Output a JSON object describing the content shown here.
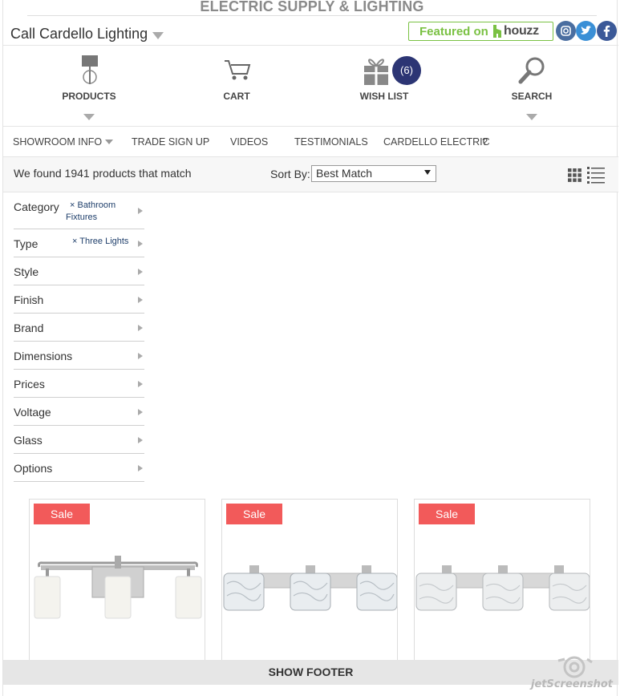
{
  "banner": {
    "text": "ELECTRIC SUPPLY & LIGHTING"
  },
  "header": {
    "call_label": "Call Cardello Lighting",
    "houzz_featured": "Featured on",
    "houzz_brand": "houzz"
  },
  "social": {
    "instagram": "instagram-icon",
    "twitter": "twitter-icon",
    "facebook": "facebook-icon"
  },
  "mainnav": {
    "products": "PRODUCTS",
    "cart": "CART",
    "wishlist": "WISH LIST",
    "wishlist_count": "(6)",
    "search": "SEARCH"
  },
  "subnav": {
    "showroom": "SHOWROOM INFO",
    "trade": "TRADE SIGN UP",
    "videos": "VIDEOS",
    "testimonials": "TESTIMONIALS",
    "electric": "CARDELLO ELECTRIC",
    "help": "?"
  },
  "results": {
    "found_text": "We found 1941 products that match",
    "sort_label": "Sort By:",
    "sort_value": "Best Match"
  },
  "filters": [
    {
      "name": "Category",
      "chip_line1": "× Bathroom",
      "chip_line2": "Fixtures"
    },
    {
      "name": "Type",
      "chip_line1": "× Three Lights"
    },
    {
      "name": "Style"
    },
    {
      "name": "Finish"
    },
    {
      "name": "Brand"
    },
    {
      "name": "Dimensions"
    },
    {
      "name": "Prices"
    },
    {
      "name": "Voltage"
    },
    {
      "name": "Glass"
    },
    {
      "name": "Options"
    }
  ],
  "products": [
    {
      "badge": "Sale"
    },
    {
      "badge": "Sale"
    },
    {
      "badge": "Sale"
    }
  ],
  "footer": {
    "show_footer": "SHOW FOOTER"
  },
  "watermark": {
    "text": "jetScreenshot"
  },
  "colors": {
    "sale": "#f25a5a",
    "badge": "#2c3574",
    "houzz_green": "#7ac143"
  }
}
